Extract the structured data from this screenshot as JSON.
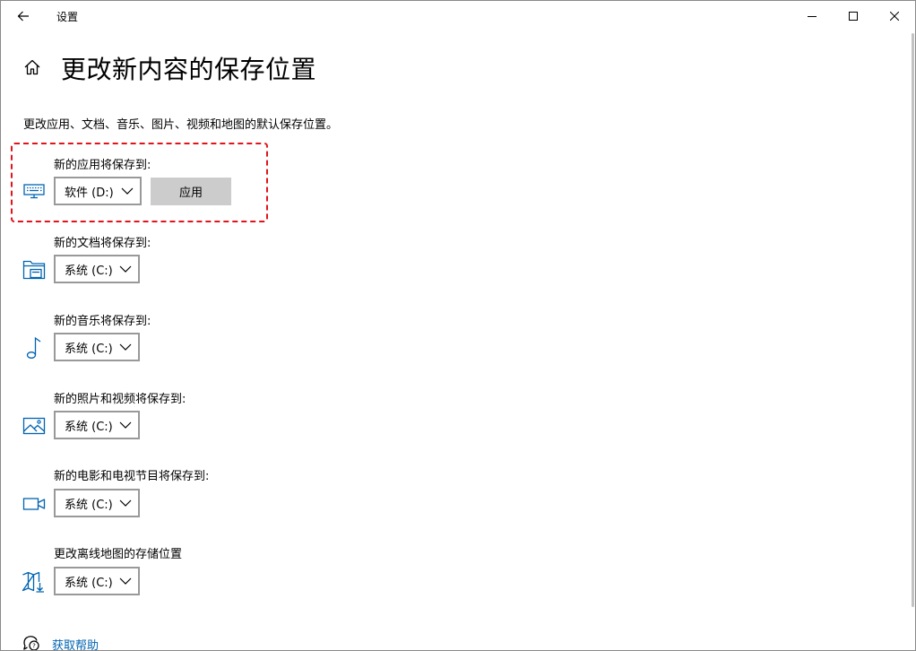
{
  "window": {
    "title": "设置",
    "back_icon": "back-arrow-icon",
    "minimize_icon": "minimize-icon",
    "maximize_icon": "maximize-icon",
    "close_icon": "close-icon"
  },
  "header": {
    "home_icon": "home-icon",
    "title": "更改新内容的保存位置",
    "description": "更改应用、文档、音乐、图片、视频和地图的默认保存位置。"
  },
  "colors": {
    "accent": "#0063b1",
    "highlight_border": "#e0141b",
    "button_bg": "#cccccc",
    "select_border": "#999999"
  },
  "rows": [
    {
      "id": "apps",
      "label": "新的应用将保存到:",
      "icon": "monitor-keyboard-icon",
      "value": "软件 (D:)",
      "apply_label": "应用"
    },
    {
      "id": "documents",
      "label": "新的文档将保存到:",
      "icon": "folder-drive-icon",
      "value": "系统 (C:)"
    },
    {
      "id": "music",
      "label": "新的音乐将保存到:",
      "icon": "music-note-icon",
      "value": "系统 (C:)"
    },
    {
      "id": "photos",
      "label": "新的照片和视频将保存到:",
      "icon": "picture-icon",
      "value": "系统 (C:)"
    },
    {
      "id": "movies",
      "label": "新的电影和电视节目将保存到:",
      "icon": "video-camera-icon",
      "value": "系统 (C:)"
    },
    {
      "id": "maps",
      "label": "更改离线地图的存储位置",
      "icon": "map-download-icon",
      "value": "系统 (C:)"
    }
  ],
  "help": {
    "icon": "help-chat-icon",
    "label": "获取帮助"
  }
}
